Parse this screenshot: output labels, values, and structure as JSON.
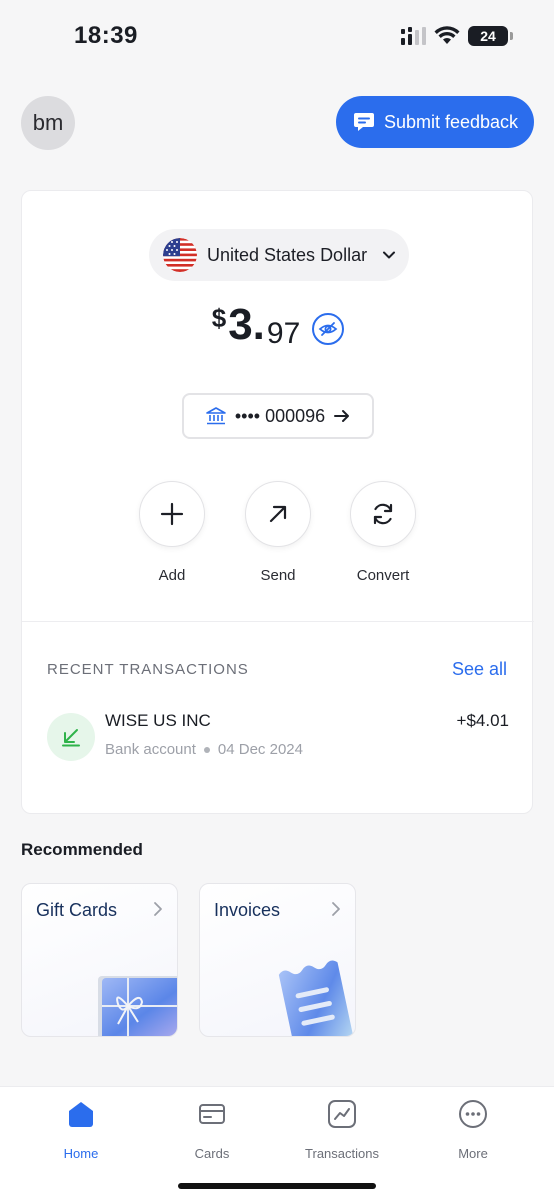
{
  "status_bar": {
    "time": "18:39",
    "battery": "24"
  },
  "header": {
    "avatar_initials": "bm",
    "feedback_label": "Submit feedback"
  },
  "balance_card": {
    "currency_name": "United States Dollar",
    "currency_symbol": "$",
    "balance_integer": "3.",
    "balance_decimal": "97",
    "account_masked": "•••• 000096",
    "actions": [
      {
        "label": "Add",
        "icon": "plus-icon"
      },
      {
        "label": "Send",
        "icon": "arrow-up-right-icon"
      },
      {
        "label": "Convert",
        "icon": "refresh-icon"
      }
    ]
  },
  "transactions": {
    "header": "RECENT TRANSACTIONS",
    "see_all": "See all",
    "items": [
      {
        "name": "WISE US INC",
        "type": "Bank account",
        "date": "04 Dec 2024",
        "amount": "+$4.01",
        "icon": "incoming-arrow-icon"
      }
    ]
  },
  "recommended": {
    "title": "Recommended",
    "cards": [
      {
        "title": "Gift Cards"
      },
      {
        "title": "Invoices"
      }
    ]
  },
  "tab_bar": {
    "tabs": [
      {
        "label": "Home",
        "icon": "home-icon",
        "active": true
      },
      {
        "label": "Cards",
        "icon": "card-icon",
        "active": false
      },
      {
        "label": "Transactions",
        "icon": "chart-icon",
        "active": false
      },
      {
        "label": "More",
        "icon": "more-icon",
        "active": false
      }
    ]
  },
  "colors": {
    "accent": "#2b6ded",
    "positive": "#2fb34a",
    "background": "#f6f6f7"
  }
}
